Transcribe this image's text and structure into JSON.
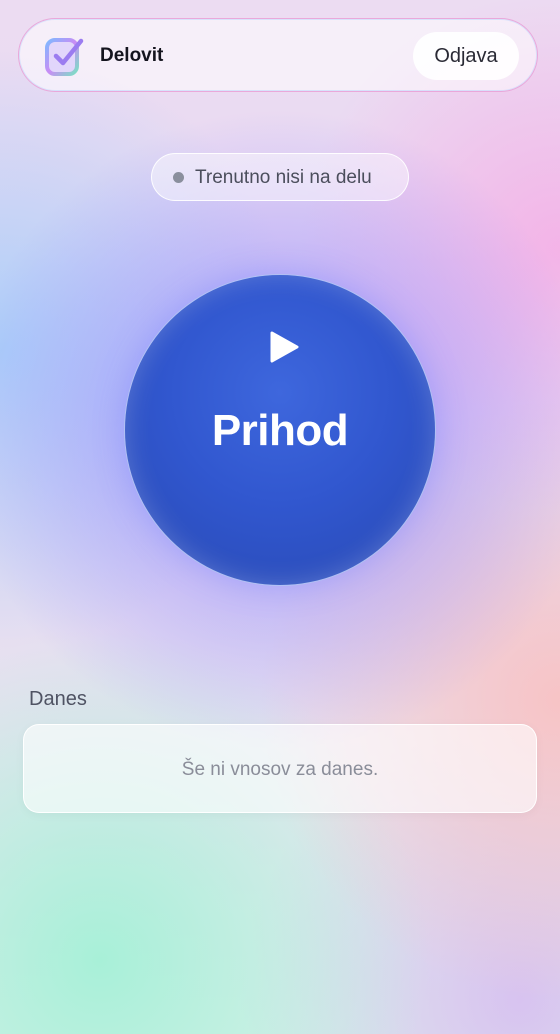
{
  "header": {
    "app_name": "Delovit",
    "logo_icon": "checkbox-logo-icon",
    "logout_label": "Odjava"
  },
  "status": {
    "text": "Trenutno nisi na delu",
    "indicator_color": "#8a8f9d"
  },
  "action": {
    "icon": "play-icon",
    "label": "Prihod",
    "color": "#3157cf"
  },
  "today": {
    "title": "Danes",
    "empty_message": "Še ni vnosov za danes."
  }
}
